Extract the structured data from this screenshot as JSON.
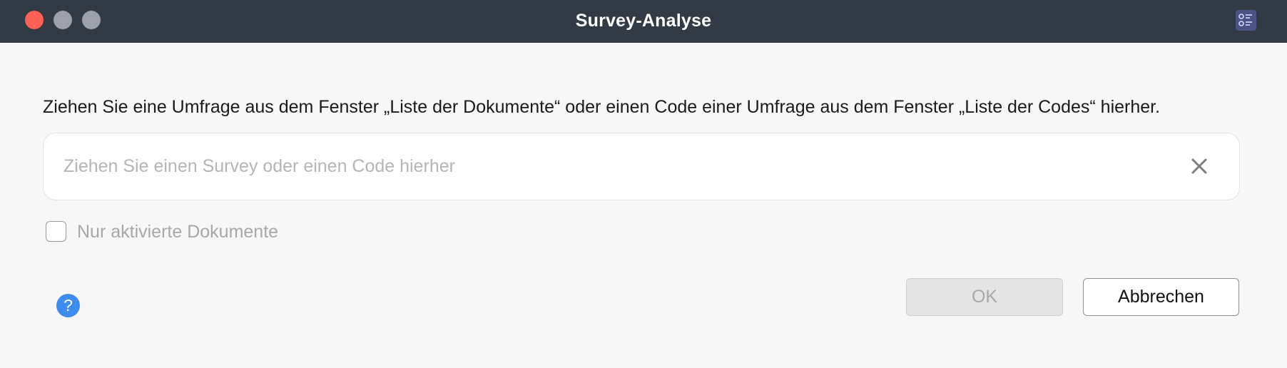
{
  "window": {
    "title": "Survey-Analyse"
  },
  "titlebar_icons": {
    "close": "close-window-icon",
    "minimize": "minimize-window-icon",
    "maximize": "maximize-window-icon",
    "right": "list-settings-icon"
  },
  "content": {
    "instruction": "Ziehen Sie eine Umfrage aus dem Fenster „Liste der Dokumente“ oder einen Code einer Umfrage aus dem Fenster „Liste der Codes“ hierher.",
    "dropzone": {
      "value": "",
      "placeholder": "Ziehen Sie einen Survey oder einen Code hierher"
    },
    "checkbox": {
      "label": "Nur aktivierte Dokumente",
      "checked": false
    }
  },
  "footer": {
    "help_symbol": "?",
    "ok_label": "OK",
    "cancel_label": "Abbrechen"
  },
  "colors": {
    "titlebar": "#323a46",
    "close_light": "#fe5f57",
    "help": "#3f8cf0"
  }
}
